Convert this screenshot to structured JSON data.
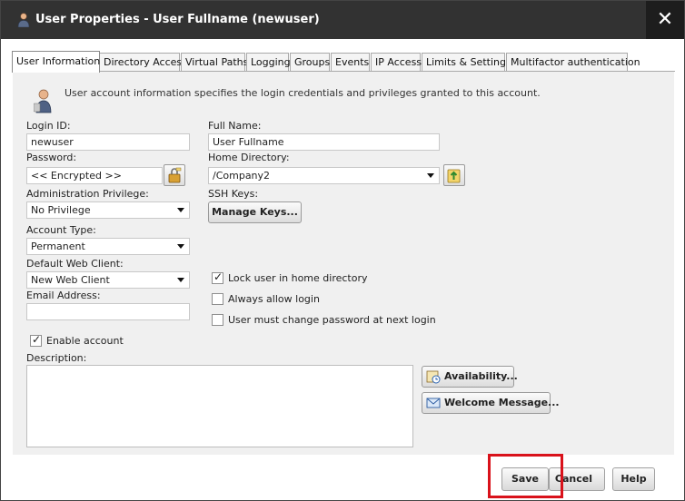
{
  "window": {
    "title": "User Properties - User Fullname (newuser)",
    "close_label": "✕"
  },
  "tabs": [
    {
      "label": "User Information",
      "active": true
    },
    {
      "label": "Directory Access"
    },
    {
      "label": "Virtual Paths"
    },
    {
      "label": "Logging"
    },
    {
      "label": "Groups"
    },
    {
      "label": "Events"
    },
    {
      "label": "IP Access"
    },
    {
      "label": "Limits & Settings"
    },
    {
      "label": "Multifactor authentication"
    }
  ],
  "info": {
    "text": "User account information specifies the login credentials and privileges granted to this account."
  },
  "form": {
    "login_id": {
      "label": "Login ID:",
      "value": "newuser"
    },
    "full_name": {
      "label": "Full Name:",
      "value": "User Fullname"
    },
    "password": {
      "label": "Password:",
      "value": "<< Encrypted >>"
    },
    "home_directory": {
      "label": "Home Directory:",
      "value": "/Company2"
    },
    "admin_privilege": {
      "label": "Administration Privilege:",
      "value": "No Privilege"
    },
    "ssh_keys": {
      "label": "SSH Keys:",
      "button": "Manage Keys..."
    },
    "account_type": {
      "label": "Account Type:",
      "value": "Permanent"
    },
    "default_web_client": {
      "label": "Default Web Client:",
      "value": "New Web Client"
    },
    "email": {
      "label": "Email Address:",
      "value": ""
    },
    "lock_home": {
      "label": "Lock user in home directory",
      "checked": true
    },
    "always_allow_login": {
      "label": "Always allow login",
      "checked": false
    },
    "must_change_password": {
      "label": "User must change password at next login",
      "checked": false
    },
    "enable_account": {
      "label": "Enable account",
      "checked": true
    },
    "description": {
      "label": "Description:",
      "value": ""
    }
  },
  "side_buttons": {
    "availability": "Availability...",
    "welcome": "Welcome Message..."
  },
  "footer": {
    "save": "Save",
    "cancel": "Cancel",
    "help": "Help"
  },
  "colors": {
    "titlebar": "#323232",
    "highlight": "#d9121b",
    "panel": "#f0f0f0"
  }
}
